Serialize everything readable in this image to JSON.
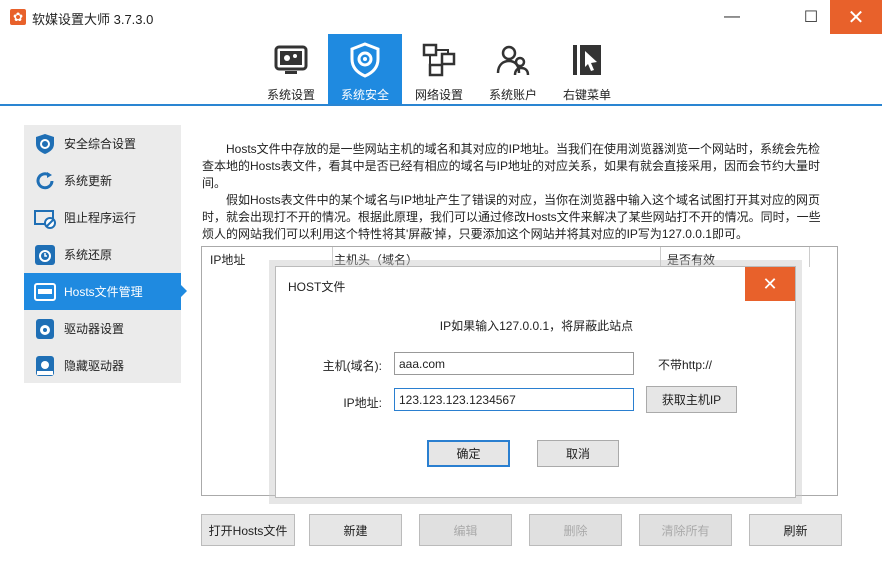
{
  "window": {
    "title": "软媒设置大师 3.7.3.0",
    "min_icon": "—",
    "max_icon": "☐",
    "close_icon": "✕",
    "accent": "#e8612b",
    "blue": "#1f8ae0"
  },
  "toolbar": {
    "items": [
      {
        "label": "系统设置",
        "icon": "gear-screen-icon"
      },
      {
        "label": "系统安全",
        "icon": "shield-icon"
      },
      {
        "label": "网络设置",
        "icon": "network-icon"
      },
      {
        "label": "系统账户",
        "icon": "users-icon"
      },
      {
        "label": "右键菜单",
        "icon": "cursor-menu-icon"
      }
    ],
    "active": "系统安全"
  },
  "sidebar": {
    "items": [
      {
        "label": "安全综合设置"
      },
      {
        "label": "系统更新"
      },
      {
        "label": "阻止程序运行"
      },
      {
        "label": "系统还原"
      },
      {
        "label": "Hosts文件管理"
      },
      {
        "label": "驱动器设置"
      },
      {
        "label": "隐藏驱动器"
      }
    ],
    "active": "Hosts文件管理"
  },
  "description": {
    "p1": "Hosts文件中存放的是一些网站主机的域名和其对应的IP地址。当我们在使用浏览器浏览一个网站时，系统会先检查本地的Hosts表文件，看其中是否已经有相应的域名与IP地址的对应关系，如果有就会直接采用，因而会节约大量时间。",
    "p2": "假如Hosts表文件中的某个域名与IP地址产生了错误的对应，当你在浏览器中输入这个域名试图打开其对应的网页时，就会出现打不开的情况。根据此原理，我们可以通过修改Hosts文件来解决了某些网站打不开的情况。同时，一些烦人的网站我们可以利用这个特性将其'屏蔽'掉，只要添加这个网站并将其对应的IP写为127.0.0.1即可。"
  },
  "table": {
    "columns": [
      "IP地址",
      "主机头（域名）",
      "是否有效"
    ]
  },
  "buttons": {
    "open_hosts": "打开Hosts文件",
    "new": "新建",
    "edit": "编辑",
    "delete": "删除",
    "clear_all": "清除所有",
    "refresh": "刷新"
  },
  "dialog": {
    "title": "HOST文件",
    "hint": "IP如果输入127.0.0.1，将屏蔽此站点",
    "host_label": "主机(域名):",
    "host_value": "aaa.com",
    "host_note": "不带http://",
    "ip_label": "IP地址:",
    "ip_value": "123.123.123.1234567",
    "get_ip": "获取主机IP",
    "ok": "确定",
    "cancel": "取消",
    "close_icon": "✕"
  }
}
